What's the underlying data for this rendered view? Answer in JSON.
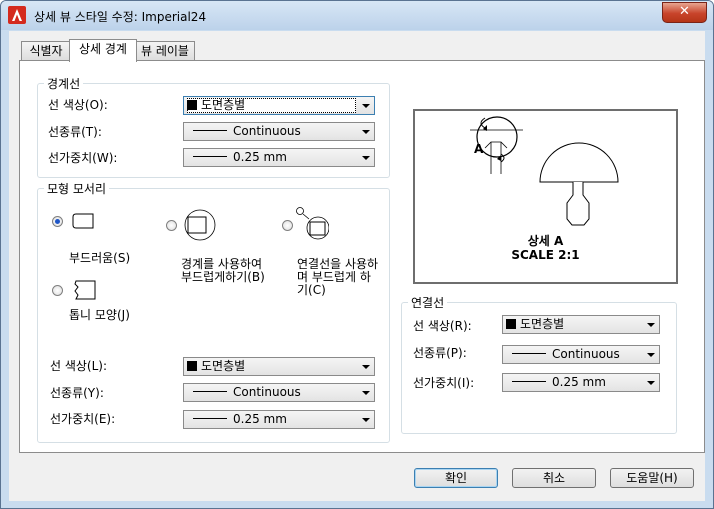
{
  "window": {
    "title": "상세 뷰 스타일 수정: Imperial24",
    "close_label": "✕"
  },
  "tabs": [
    {
      "label": "식별자"
    },
    {
      "label": "상세 경계"
    },
    {
      "label": "뷰 레이블"
    }
  ],
  "boundary": {
    "title": "경계선",
    "color_label": "선 색상(O):",
    "color_value": "도면층별",
    "linetype_label": "선종류(T):",
    "linetype_value": "Continuous",
    "lineweight_label": "선가중치(W):",
    "lineweight_value": "0.25 mm"
  },
  "model_edge": {
    "title": "모형 모서리",
    "smooth_label": "부드러움(S)",
    "smooth_border_label": "경계를 사용하여 부드럽게하기(B)",
    "smooth_connect_label": "연결선을 사용하며 부드럽게 하기(C)",
    "jagged_label": "톱니 모양(J)",
    "color_label": "선 색상(L):",
    "color_value": "도면층별",
    "linetype_label": "선종류(Y):",
    "linetype_value": "Continuous",
    "lineweight_label": "선가중치(E):",
    "lineweight_value": "0.25 mm"
  },
  "preview": {
    "callout": "A",
    "label_line1": "상세 A",
    "label_line2": "SCALE 2:1"
  },
  "connector": {
    "title": "연결선",
    "color_label": "선 색상(R):",
    "color_value": "도면층별",
    "linetype_label": "선종류(P):",
    "linetype_value": "Continuous",
    "lineweight_label": "선가중치(I):",
    "lineweight_value": "0.25 mm"
  },
  "buttons": {
    "ok": "확인",
    "cancel": "취소",
    "help": "도움말(H)"
  }
}
